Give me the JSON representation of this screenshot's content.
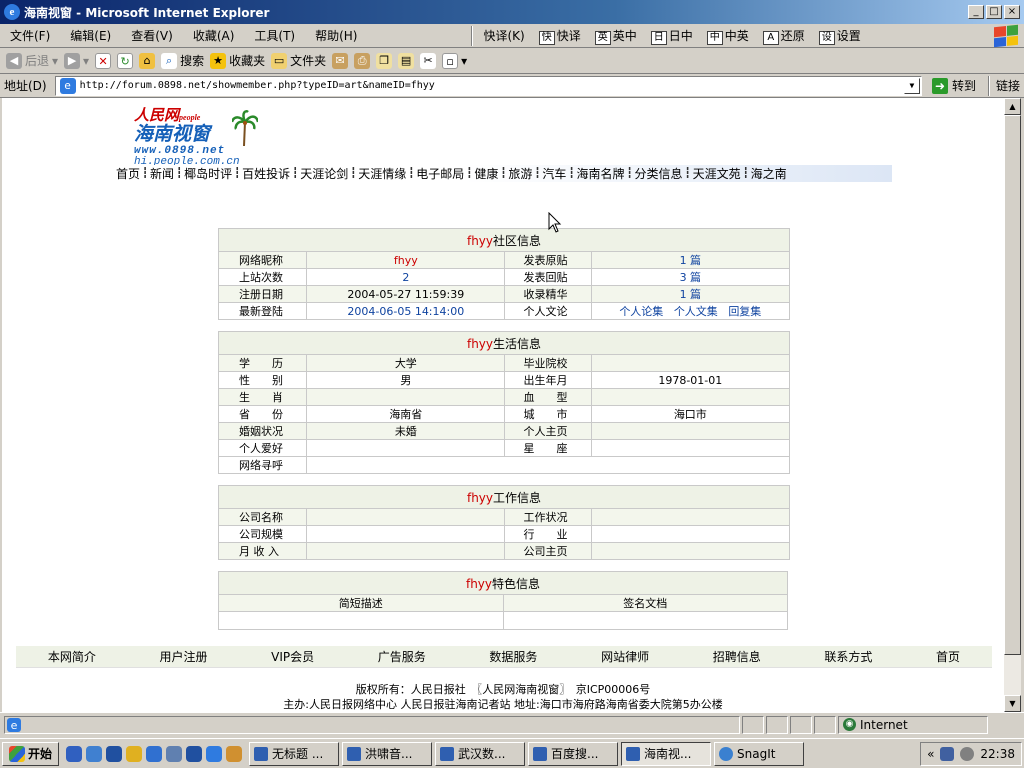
{
  "window": {
    "title": "海南视窗 - Microsoft Internet Explorer",
    "buttons": [
      "_",
      "□",
      "×"
    ]
  },
  "menu": [
    "文件(F)",
    "编辑(E)",
    "查看(V)",
    "收藏(A)",
    "工具(T)",
    "帮助(H)"
  ],
  "ime": {
    "label": "快译(K)",
    "items": [
      {
        "badge": "快",
        "label": "快译"
      },
      {
        "badge": "英",
        "label": "英中"
      },
      {
        "badge": "日",
        "label": "日中"
      },
      {
        "badge": "中",
        "label": "中英"
      },
      {
        "badge": "A",
        "label": "还原"
      },
      {
        "badge": "设",
        "label": "设置"
      }
    ]
  },
  "toolbar": {
    "back": "后退",
    "search": "搜索",
    "favorites": "收藏夹",
    "folders": "文件夹"
  },
  "address": {
    "label": "地址(D)",
    "url": "http://forum.0898.net/showmember.php?typeID=art&nameID=fhyy",
    "go": "转到",
    "links": "链接"
  },
  "logo": {
    "line1": "人民网",
    "line1b": "people",
    "line2": "海南视窗",
    "line3": "www.0898.net",
    "line4": "hi.people.com.cn"
  },
  "nav": [
    "首页",
    "新闻",
    "椰岛时评",
    "百姓投诉",
    "天涯论剑",
    "天涯情缘",
    "电子邮局",
    "健康",
    "旅游",
    "汽车",
    "海南名牌",
    "分类信息",
    "天涯文苑",
    "海之南"
  ],
  "community": {
    "user": "fhyy",
    "title": "社区信息",
    "rows": [
      {
        "l1": "网络昵称",
        "v1": "fhyy",
        "l2": "发表原贴",
        "v2": "1 篇"
      },
      {
        "l1": "上站次数",
        "v1": "2",
        "l2": "发表回贴",
        "v2": "3 篇"
      },
      {
        "l1": "注册日期",
        "v1": "2004-05-27 11:59:39",
        "l2": "收录精华",
        "v2": "1 篇"
      },
      {
        "l1": "最新登陆",
        "v1": "2004-06-05 14:14:00",
        "l2": "个人文论"
      }
    ],
    "links": [
      "个人论集",
      "个人文集",
      "回复集"
    ]
  },
  "life": {
    "user": "fhyy",
    "title": "生活信息",
    "rows": [
      {
        "l1": "学　　历",
        "v1": "大学",
        "l2": "毕业院校",
        "v2": ""
      },
      {
        "l1": "性　　别",
        "v1": "男",
        "l2": "出生年月",
        "v2": "1978-01-01"
      },
      {
        "l1": "生　　肖",
        "v1": "",
        "l2": "血　　型",
        "v2": ""
      },
      {
        "l1": "省　　份",
        "v1": "海南省",
        "l2": "城　　市",
        "v2": "海口市"
      },
      {
        "l1": "婚姻状况",
        "v1": "未婚",
        "l2": "个人主页",
        "v2": ""
      },
      {
        "l1": "个人爱好",
        "v1": "",
        "l2": "星　　座",
        "v2": ""
      }
    ],
    "last_label": "网络寻呼"
  },
  "work": {
    "user": "fhyy",
    "title": "工作信息",
    "rows": [
      {
        "l1": "公司名称",
        "l2": "工作状况"
      },
      {
        "l1": "公司规模",
        "l2": "行　　业"
      },
      {
        "l1": "月 收 入",
        "l2": "公司主页"
      }
    ]
  },
  "special": {
    "user": "fhyy",
    "title": "特色信息",
    "col1": "简短描述",
    "col2": "签名文档"
  },
  "footer_nav": [
    "本网简介",
    "用户注册",
    "VIP会员",
    "广告服务",
    "数据服务",
    "网站律师",
    "招聘信息",
    "联系方式",
    "首页"
  ],
  "copyright": {
    "line1": "版权所有：人民日报社　〖人民网海南视窗〗　京ICP00006号",
    "line2": "主办:人民日报网络中心 人民日报驻海南记者站 地址:海口市海府路海南省委大院第5办公楼"
  },
  "status": {
    "zone": "Internet"
  },
  "taskbar": {
    "start": "开始",
    "tasks": [
      "无标题 ...",
      "洪啸音...",
      "武汉数...",
      "百度搜...",
      "海南视...",
      "SnagIt"
    ],
    "clock": "22:38"
  },
  "colors": {
    "title_gradient_start": "#0a246a",
    "link": "#1044a0",
    "username": "#c00000",
    "header_bg": "#eef2e6"
  }
}
